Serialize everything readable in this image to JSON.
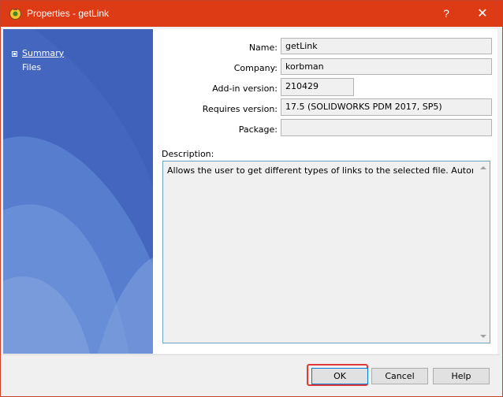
{
  "window": {
    "title": "Properties - getLink",
    "help_button": "?",
    "close_button": "✕"
  },
  "sidebar": {
    "items": [
      {
        "label": "Summary"
      },
      {
        "label": "Files"
      }
    ]
  },
  "fields": {
    "name": {
      "label": "Name:",
      "value": "getLink"
    },
    "company": {
      "label": "Company:",
      "value": "korbman"
    },
    "addin_version": {
      "label": "Add-in version:",
      "value": "210429"
    },
    "requires_version": {
      "label": "Requires version:",
      "value": "17.5 (SOLIDWORKS PDM 2017, SP5)"
    },
    "package": {
      "label": "Package:",
      "value": ""
    }
  },
  "description": {
    "label": "Description:",
    "value": "Allows the user to get different types of links to the selected file. Autor: koroboko"
  },
  "buttons": {
    "ok": "OK",
    "cancel": "Cancel",
    "help": "Help"
  },
  "colors": {
    "titlebar": "#dd3b16",
    "sidebar": "#4a6dc2",
    "ok_highlight": "#e03a3a"
  },
  "icons": {
    "app": "pdm-addin-icon",
    "help": "question-mark",
    "close": "close-x",
    "nav_bullet": "bullet-square"
  }
}
